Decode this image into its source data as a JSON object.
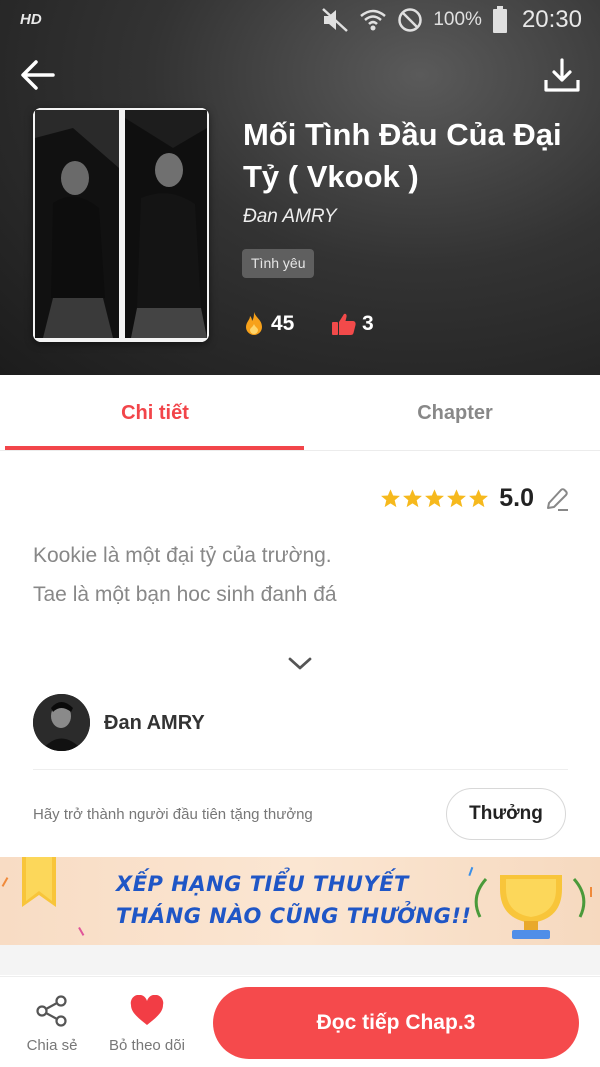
{
  "status_bar": {
    "hd_label": "HD",
    "battery_percent": "100%",
    "time": "20:30"
  },
  "header": {
    "back_icon": "arrow-left-icon",
    "download_icon": "download-icon"
  },
  "book": {
    "title": "Mối Tình Đầu Của Đại Tỷ ( Vkook )",
    "author": "Đan AMRY",
    "genre": "Tình yêu",
    "fire_count": "45",
    "like_count": "3"
  },
  "tabs": [
    {
      "label": "Chi tiết",
      "active": true
    },
    {
      "label": "Chapter",
      "active": false
    }
  ],
  "rating": {
    "value": "5.0",
    "stars": 5
  },
  "description": {
    "line1": "Kookie là một đại tỷ của trường.",
    "line2": "Tae là một bạn hoc sinh đanh đá"
  },
  "author_section": {
    "name": "Đan AMRY"
  },
  "reward": {
    "prompt": "Hãy trở thành người đầu tiên tặng thưởng",
    "button_label": "Thưởng"
  },
  "banner": {
    "line1": "XẾP HẠNG TIỂU THUYẾT",
    "line2": "THÁNG NÀO CŨNG THƯỞNG!!"
  },
  "bottom_bar": {
    "share_label": "Chia sẻ",
    "unfollow_label": "Bỏ theo dõi",
    "read_button_label": "Đọc tiếp Chap.3"
  },
  "colors": {
    "accent": "#f54a4c",
    "banner_text": "#1f56c6",
    "star": "#f6b91d"
  }
}
